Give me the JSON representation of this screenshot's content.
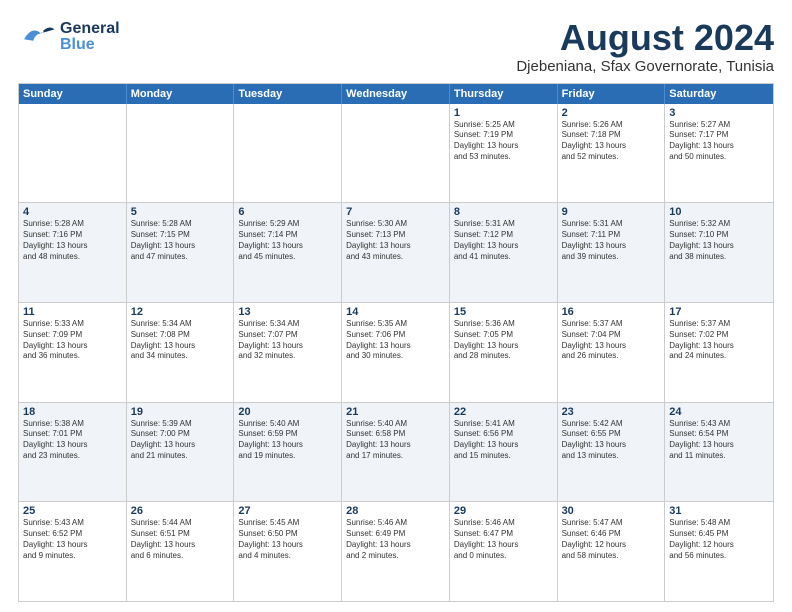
{
  "header": {
    "logo_general": "General",
    "logo_blue": "Blue",
    "main_title": "August 2024",
    "subtitle": "Djebeniana, Sfax Governorate, Tunisia"
  },
  "days": [
    "Sunday",
    "Monday",
    "Tuesday",
    "Wednesday",
    "Thursday",
    "Friday",
    "Saturday"
  ],
  "weeks": [
    {
      "alt": false,
      "cells": [
        {
          "day": "",
          "text": ""
        },
        {
          "day": "",
          "text": ""
        },
        {
          "day": "",
          "text": ""
        },
        {
          "day": "",
          "text": ""
        },
        {
          "day": "1",
          "text": "Sunrise: 5:25 AM\nSunset: 7:19 PM\nDaylight: 13 hours\nand 53 minutes."
        },
        {
          "day": "2",
          "text": "Sunrise: 5:26 AM\nSunset: 7:18 PM\nDaylight: 13 hours\nand 52 minutes."
        },
        {
          "day": "3",
          "text": "Sunrise: 5:27 AM\nSunset: 7:17 PM\nDaylight: 13 hours\nand 50 minutes."
        }
      ]
    },
    {
      "alt": true,
      "cells": [
        {
          "day": "4",
          "text": "Sunrise: 5:28 AM\nSunset: 7:16 PM\nDaylight: 13 hours\nand 48 minutes."
        },
        {
          "day": "5",
          "text": "Sunrise: 5:28 AM\nSunset: 7:15 PM\nDaylight: 13 hours\nand 47 minutes."
        },
        {
          "day": "6",
          "text": "Sunrise: 5:29 AM\nSunset: 7:14 PM\nDaylight: 13 hours\nand 45 minutes."
        },
        {
          "day": "7",
          "text": "Sunrise: 5:30 AM\nSunset: 7:13 PM\nDaylight: 13 hours\nand 43 minutes."
        },
        {
          "day": "8",
          "text": "Sunrise: 5:31 AM\nSunset: 7:12 PM\nDaylight: 13 hours\nand 41 minutes."
        },
        {
          "day": "9",
          "text": "Sunrise: 5:31 AM\nSunset: 7:11 PM\nDaylight: 13 hours\nand 39 minutes."
        },
        {
          "day": "10",
          "text": "Sunrise: 5:32 AM\nSunset: 7:10 PM\nDaylight: 13 hours\nand 38 minutes."
        }
      ]
    },
    {
      "alt": false,
      "cells": [
        {
          "day": "11",
          "text": "Sunrise: 5:33 AM\nSunset: 7:09 PM\nDaylight: 13 hours\nand 36 minutes."
        },
        {
          "day": "12",
          "text": "Sunrise: 5:34 AM\nSunset: 7:08 PM\nDaylight: 13 hours\nand 34 minutes."
        },
        {
          "day": "13",
          "text": "Sunrise: 5:34 AM\nSunset: 7:07 PM\nDaylight: 13 hours\nand 32 minutes."
        },
        {
          "day": "14",
          "text": "Sunrise: 5:35 AM\nSunset: 7:06 PM\nDaylight: 13 hours\nand 30 minutes."
        },
        {
          "day": "15",
          "text": "Sunrise: 5:36 AM\nSunset: 7:05 PM\nDaylight: 13 hours\nand 28 minutes."
        },
        {
          "day": "16",
          "text": "Sunrise: 5:37 AM\nSunset: 7:04 PM\nDaylight: 13 hours\nand 26 minutes."
        },
        {
          "day": "17",
          "text": "Sunrise: 5:37 AM\nSunset: 7:02 PM\nDaylight: 13 hours\nand 24 minutes."
        }
      ]
    },
    {
      "alt": true,
      "cells": [
        {
          "day": "18",
          "text": "Sunrise: 5:38 AM\nSunset: 7:01 PM\nDaylight: 13 hours\nand 23 minutes."
        },
        {
          "day": "19",
          "text": "Sunrise: 5:39 AM\nSunset: 7:00 PM\nDaylight: 13 hours\nand 21 minutes."
        },
        {
          "day": "20",
          "text": "Sunrise: 5:40 AM\nSunset: 6:59 PM\nDaylight: 13 hours\nand 19 minutes."
        },
        {
          "day": "21",
          "text": "Sunrise: 5:40 AM\nSunset: 6:58 PM\nDaylight: 13 hours\nand 17 minutes."
        },
        {
          "day": "22",
          "text": "Sunrise: 5:41 AM\nSunset: 6:56 PM\nDaylight: 13 hours\nand 15 minutes."
        },
        {
          "day": "23",
          "text": "Sunrise: 5:42 AM\nSunset: 6:55 PM\nDaylight: 13 hours\nand 13 minutes."
        },
        {
          "day": "24",
          "text": "Sunrise: 5:43 AM\nSunset: 6:54 PM\nDaylight: 13 hours\nand 11 minutes."
        }
      ]
    },
    {
      "alt": false,
      "cells": [
        {
          "day": "25",
          "text": "Sunrise: 5:43 AM\nSunset: 6:52 PM\nDaylight: 13 hours\nand 9 minutes."
        },
        {
          "day": "26",
          "text": "Sunrise: 5:44 AM\nSunset: 6:51 PM\nDaylight: 13 hours\nand 6 minutes."
        },
        {
          "day": "27",
          "text": "Sunrise: 5:45 AM\nSunset: 6:50 PM\nDaylight: 13 hours\nand 4 minutes."
        },
        {
          "day": "28",
          "text": "Sunrise: 5:46 AM\nSunset: 6:49 PM\nDaylight: 13 hours\nand 2 minutes."
        },
        {
          "day": "29",
          "text": "Sunrise: 5:46 AM\nSunset: 6:47 PM\nDaylight: 13 hours\nand 0 minutes."
        },
        {
          "day": "30",
          "text": "Sunrise: 5:47 AM\nSunset: 6:46 PM\nDaylight: 12 hours\nand 58 minutes."
        },
        {
          "day": "31",
          "text": "Sunrise: 5:48 AM\nSunset: 6:45 PM\nDaylight: 12 hours\nand 56 minutes."
        }
      ]
    }
  ]
}
